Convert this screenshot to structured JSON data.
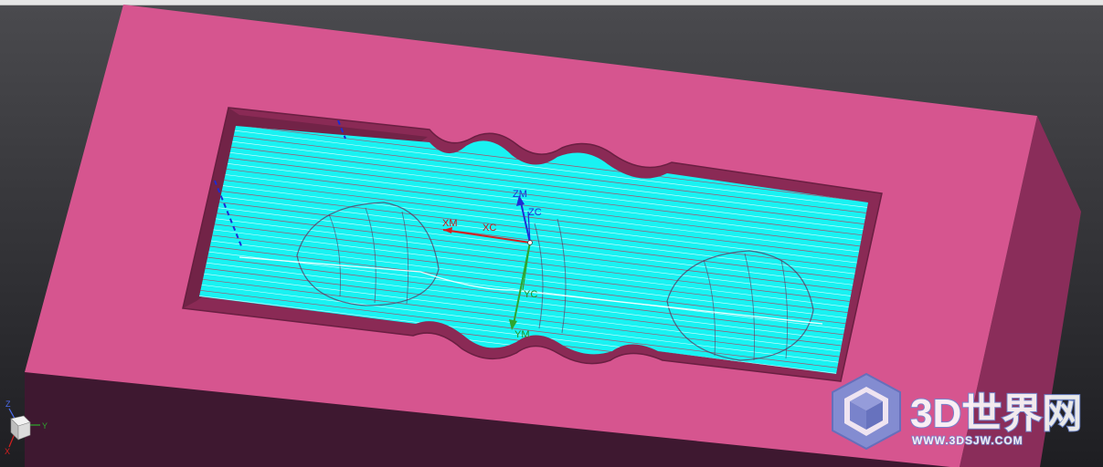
{
  "viewport": {
    "background_color": "#2f2f33",
    "part_color": "#d6558f",
    "toolpath_color": "#19f2f2"
  },
  "axes": {
    "zm": "ZM",
    "zc": "ZC",
    "xm": "XM",
    "xc": "XC",
    "yc": "YC",
    "ym": "YM"
  },
  "triad": {
    "z": "Z",
    "y": "Y",
    "x": "X"
  },
  "watermark": {
    "title": "3D世界网",
    "url": "WWW.3DSJW.COM"
  }
}
